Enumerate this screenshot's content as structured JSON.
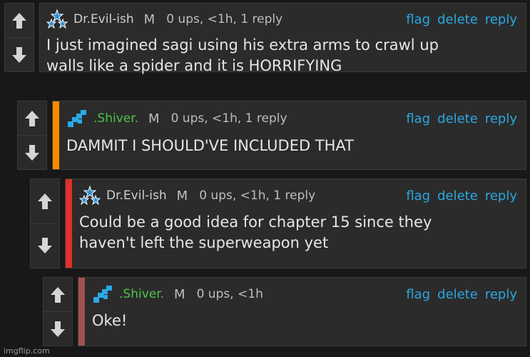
{
  "comments": [
    {
      "username": "Dr.Evil-ish",
      "rank": "M",
      "stats": "0 ups, <1h, 1 reply",
      "text_lines": [
        "I just imagined sagi using his extra arms to crawl up",
        "walls like a spider and it is HORRIFYING"
      ],
      "stripe_color": ""
    },
    {
      "username": ".Shiver.",
      "rank": "M",
      "stats": "0 ups, <1h, 1 reply",
      "text_lines": [
        "DAMMIT I SHOULD'VE INCLUDED THAT"
      ],
      "stripe_color": "#ff8a00"
    },
    {
      "username": "Dr.Evil-ish",
      "rank": "M",
      "stats": "0 ups, <1h, 1 reply",
      "text_lines": [
        "Could be a good idea for chapter 15 since they",
        "haven't left the superweapon yet"
      ],
      "stripe_color": "#e0302b"
    },
    {
      "username": ".Shiver.",
      "rank": "M",
      "stats": "0 ups, <1h",
      "text_lines": [
        "Oke!"
      ],
      "stripe_color": "#a0524f"
    }
  ],
  "actions": {
    "flag": "flag",
    "delete": "delete",
    "reply": "reply"
  },
  "watermark": "imgflip.com"
}
